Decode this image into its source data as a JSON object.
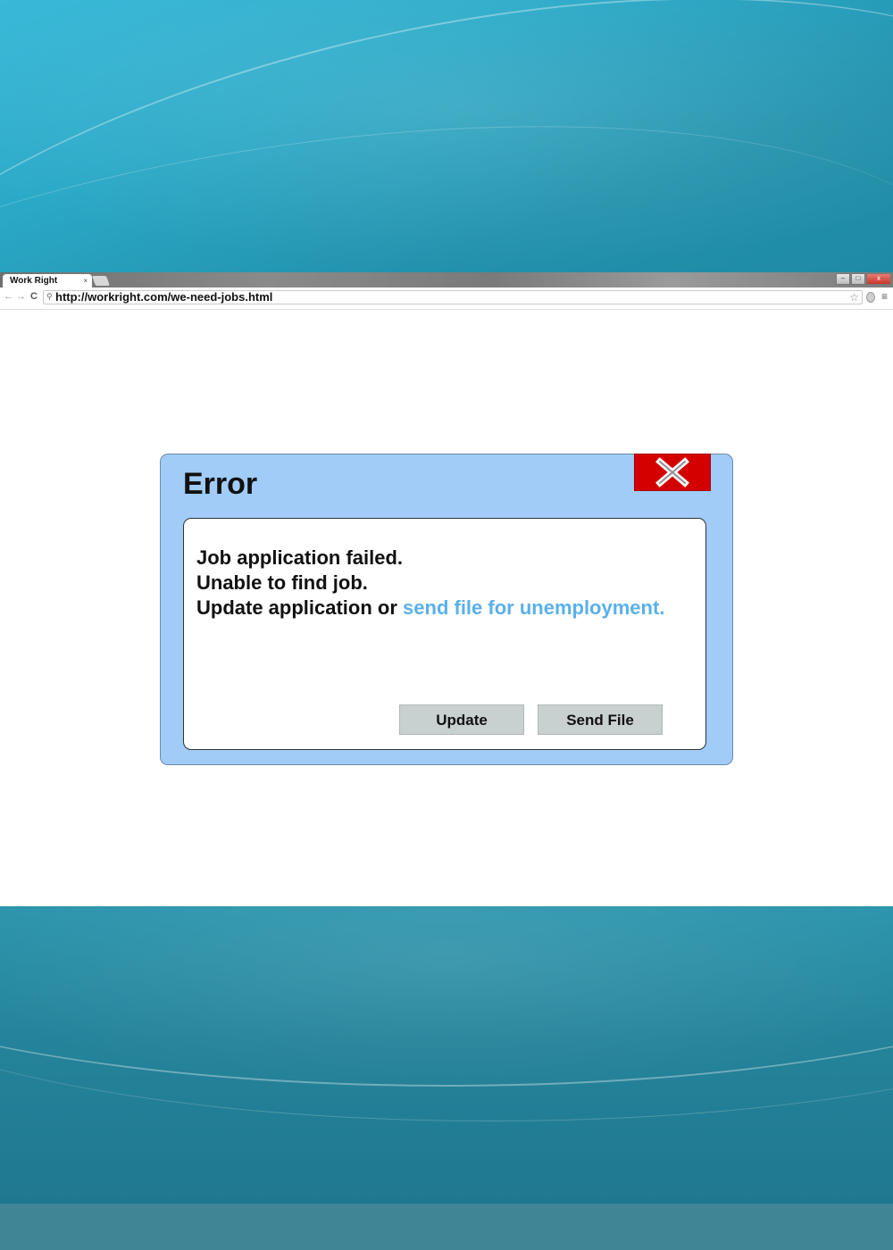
{
  "browser": {
    "tab_title": "Work Right",
    "tab_close_label": "×",
    "url": "http://workright.com/we-need-jobs.html",
    "nav": {
      "back_glyph": "←",
      "forward_glyph": "→",
      "reload_glyph": "C"
    },
    "window_controls": {
      "minimize": "–",
      "maximize": "□",
      "close": "x"
    }
  },
  "dialog": {
    "title": "Error",
    "message_line1": "Job application failed.",
    "message_line2": "Unable to find job.",
    "message_line3_prefix": "Update application or ",
    "message_line3_link": "send file for unemployment.",
    "buttons": {
      "update": "Update",
      "send_file": "Send File"
    }
  },
  "colors": {
    "dialog_bg": "#a0ccf7",
    "close_red": "#d40000",
    "link_blue": "#5ab0ea",
    "button_gray": "#c9d0d0",
    "desktop_teal": "#2a9fbd"
  },
  "icons": {
    "dialog_close": "close-x-icon",
    "search": "search-icon",
    "bookmark": "star-icon",
    "menu": "menu-icon"
  }
}
